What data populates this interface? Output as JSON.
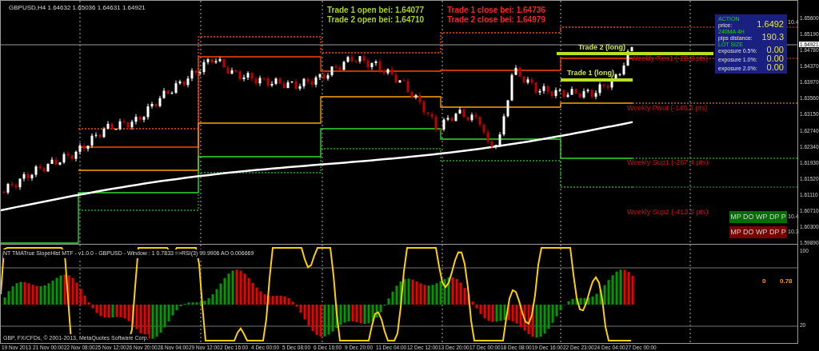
{
  "chart": {
    "header": "GBPUSD,H4  1.64632 1.65036 1.64631 1.64921",
    "trade_notes": [
      {
        "text": "Trade 1 open bei: 1.64077",
        "kind": "open"
      },
      {
        "text": "Trade 2 open bei: 1.64710",
        "kind": "open"
      },
      {
        "text": "Trade 1 close bei: 1.64736",
        "kind": "close"
      },
      {
        "text": "Trade 2 close bei: 1.64979",
        "kind": "close"
      }
    ],
    "line_labels": [
      {
        "text": "Trade 2 (long)",
        "kind": "trade"
      },
      {
        "text": "Trade 1 (long)",
        "kind": "trade"
      },
      {
        "text": "Weekly Res1 (-22.3 pts)",
        "kind": "level"
      },
      {
        "text": "Weekly Pivot (-148.4 pts)",
        "kind": "level"
      },
      {
        "text": "Weekly Sup1 (-287.4 pts)",
        "kind": "level"
      },
      {
        "text": "Weekly Sup2 (-413.5 pts)",
        "kind": "level"
      }
    ],
    "info_panel": {
      "tag": "10.4",
      "rows": [
        {
          "heading": "ACTION",
          "label": "price:",
          "value": "1.6492"
        },
        {
          "heading": "240MA 4H",
          "label": "pips distance:",
          "value": "190.3"
        },
        {
          "heading": "LOT SIZE",
          "label": "exposure 0.5%:",
          "value": "0.00"
        },
        {
          "label": "exposure 1.0%:",
          "value": "0.00"
        },
        {
          "label": "exposure 2.0%:",
          "value": "0.00"
        }
      ]
    },
    "buttons": [
      {
        "label": "MP DO WP DP P",
        "color": "#006f00",
        "tag": "10.4"
      },
      {
        "label": "MP DO WP DP P",
        "color": "#7a0000",
        "tag": "10.3"
      }
    ],
    "price_axis": [
      {
        "label": "1.65600",
        "current": false
      },
      {
        "label": "1.65190",
        "current": false
      },
      {
        "label": "1.64921",
        "current": true
      },
      {
        "label": "1.64780",
        "current": false
      },
      {
        "label": "1.64370",
        "current": false
      },
      {
        "label": "1.63970",
        "current": false
      },
      {
        "label": "1.63560",
        "current": false
      },
      {
        "label": "1.63150",
        "current": false
      },
      {
        "label": "1.62740",
        "current": false
      },
      {
        "label": "1.62340",
        "current": false
      },
      {
        "label": "1.61930",
        "current": false
      },
      {
        "label": "1.61520",
        "current": false
      },
      {
        "label": "1.61110",
        "current": false
      },
      {
        "label": "1.60710",
        "current": false
      },
      {
        "label": "1.60300",
        "current": false
      },
      {
        "label": "1.59890",
        "current": false
      }
    ]
  },
  "indicator": {
    "header": "NT TMATrue SlopeHist MTF  -  v1.0.0 - GBPUSD  -  Window : 1   0.7833  =>RSI(3) 99.9906  AO 0.006669",
    "readouts": [
      "0",
      "0.78"
    ],
    "axis": [
      "100",
      "20"
    ]
  },
  "copyright": "GBP, FX/CFDs, © 2001-2013, MetaQuotes Software Corp.",
  "time_axis": [
    "19 Nov 2013",
    "21 Nov 00:00",
    "22 Nov 08:00",
    "25 Nov 12:00",
    "26 Nov 20:00",
    "28 Nov 04:00",
    "29 Nov 12:00",
    "2 Dec 16:00",
    "4 Dec 00:00",
    "5 Dec 08:00",
    "6 Dec 16:00",
    "9 Dec 20:00",
    "11 Dec 04:00",
    "12 Dec 12:00",
    "13 Dec 20:00",
    "17 Dec 00:00",
    "18 Dec 08:00",
    "19 Dec 16:00",
    "22 Dec 23:00",
    "24 Dec 04:00",
    "27 Dec 00:00"
  ]
}
